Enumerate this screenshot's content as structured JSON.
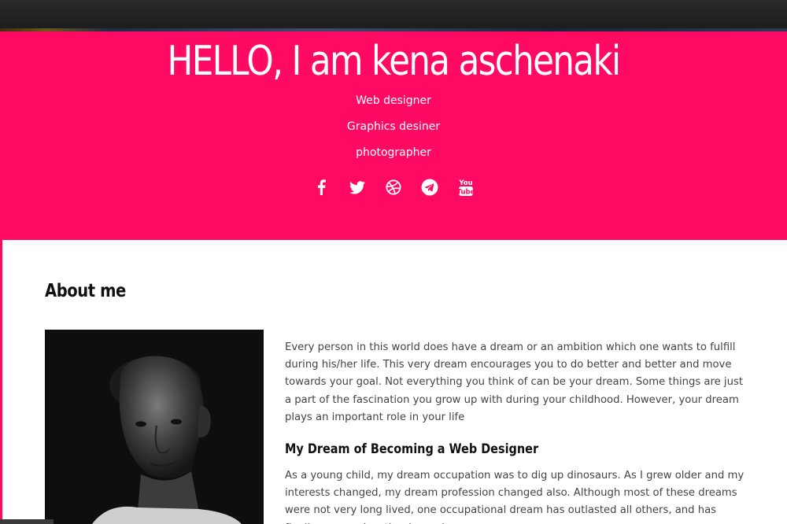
{
  "hero": {
    "title": "HELLO, I am kena aschenaki",
    "roles": [
      "Web designer",
      "Graphics desiner",
      "photographer"
    ],
    "social_icons": [
      "facebook-icon",
      "twitter-icon",
      "dribbble-icon",
      "telegram-icon",
      "youtube-icon"
    ]
  },
  "about": {
    "heading": "About me",
    "intro": "Every person in this world does have a dream or an ambition which one wants to fulfill during his/her life. This very dream encourages you to do better and better and move towards your goal. Not everything you think of can be your dream. Some things are just a part of the fascination you grow up with during your childhood. However, your dream plays an important role in your life",
    "subheading": "My Dream of Becoming a Web Designer",
    "paragraph2": "As a young child, my dream occupation was to dig up dinosaurs. As I grew older and my interests changed, my dream profession changed also. Although most of these dreams were not very long lived, one occupational dream has outlasted all others, and has finally emerged as the dream I"
  },
  "colors": {
    "accent": "#ff0a62",
    "text": "#444444",
    "heading": "#111111"
  }
}
